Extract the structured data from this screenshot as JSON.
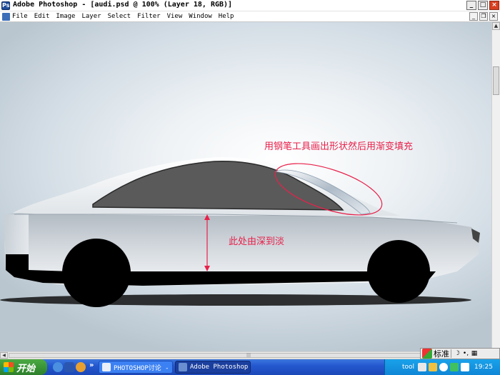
{
  "window": {
    "title": "Adobe Photoshop - [audi.psd @ 100% (Layer 18, RGB)]",
    "controls": {
      "minimize": "_",
      "maximize": "□",
      "close": "×"
    }
  },
  "menu": {
    "items": [
      "File",
      "Edit",
      "Image",
      "Layer",
      "Select",
      "Filter",
      "View",
      "Window",
      "Help"
    ],
    "doc_controls": {
      "minimize": "_",
      "restore": "❐",
      "close": "×"
    }
  },
  "canvas": {
    "annotations": {
      "top": "用钢笔工具画出形状然后用渐变填充",
      "side": "此处由深到淡"
    },
    "colors": {
      "annotation": "#e8204a",
      "body_dark": "#a4acb4",
      "body_light": "#e8eaec",
      "window": "#5a5a5a",
      "wheel": "#000000"
    }
  },
  "ime": {
    "label": "标准",
    "glyphs": [
      "☽",
      "•,",
      "▦"
    ]
  },
  "taskbar": {
    "start": "开始",
    "more": "»",
    "tasks": [
      {
        "label": "PHOTOSHOP讨论 - ...",
        "active": false
      },
      {
        "label": "Adobe Photoshop ...",
        "active": true
      }
    ],
    "tray": {
      "tool": "tool",
      "time": "19:25"
    }
  }
}
